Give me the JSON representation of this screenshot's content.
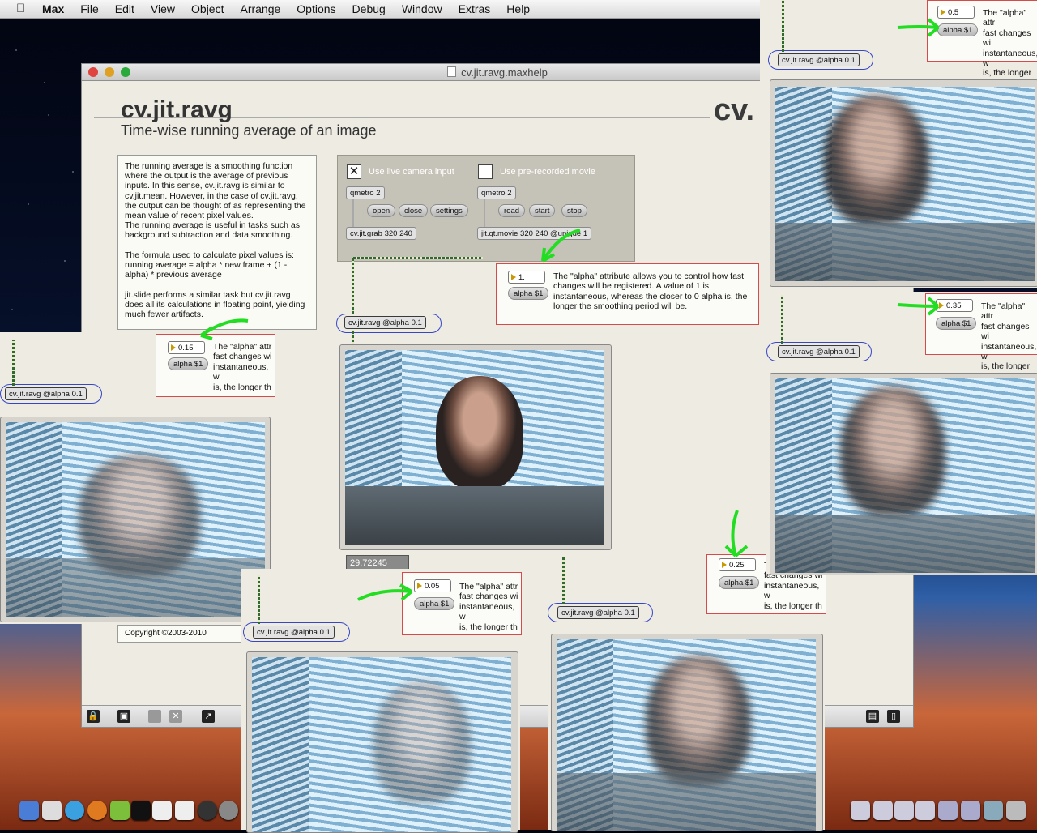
{
  "menubar": {
    "app": "Max",
    "items": [
      "File",
      "Edit",
      "View",
      "Object",
      "Arrange",
      "Options",
      "Debug",
      "Window",
      "Extras",
      "Help"
    ]
  },
  "window": {
    "title": "cv.jit.ravg.maxhelp"
  },
  "patch": {
    "title": "cv.jit.ravg",
    "subtitle": "Time-wise running average of an image",
    "watermark": "cv.",
    "description": "The running average is a smoothing function where the output is the average of previous inputs. In this sense, cv.jit.ravg is similar to cv.jit.mean. However, in the case of cv.jit.ravg, the output can be thought of as representing the mean value of recent pixel values.\nThe running average is useful in tasks such as background subtraction and data smoothing.\n\nThe formula used to calculate pixel values is:\nrunning average = alpha * new frame + (1 - alpha) * previous average\n\njit.slide performs a similar task but cv.jit.ravg does all its calculations in floating point, yielding much fewer artifacts.",
    "copyright": "Copyright ©2003-2010"
  },
  "input_panel": {
    "live_label": "Use live camera input",
    "movie_label": "Use pre-recorded movie",
    "qmetro_live": "qmetro 2",
    "qmetro_movie": "qmetro 2",
    "open": "open",
    "close": "close",
    "settings": "settings",
    "read": "read",
    "start": "start",
    "stop": "stop",
    "grab": "cv.jit.grab 320 240",
    "movie": "jit.qt.movie 320 240 @unique 1"
  },
  "alpha_comment_full": "The \"alpha\" attribute allows you to control how fast changes will be registered. A value of 1 is instantaneous, whereas the closer to 0 alpha is, the longer the smoothing period will be.",
  "alpha_comment_clip": "The \"alpha\" attr\nfast changes wi\ninstantaneous, w\nis, the longer th",
  "alpha_msg": "alpha $1",
  "ravg_object": "cv.jit.ravg @alpha 0.1",
  "alpha_values": {
    "main": "1.",
    "left": "0.15",
    "bottom": "0.05",
    "center_right": "0.25",
    "top_right": "0.5",
    "mid_right": "0.35"
  },
  "fps": "29.72245",
  "accent_colors": {
    "ravg_ring": "#3546c9",
    "comment_border": "#d64a4a",
    "arrow": "#22dd22"
  }
}
